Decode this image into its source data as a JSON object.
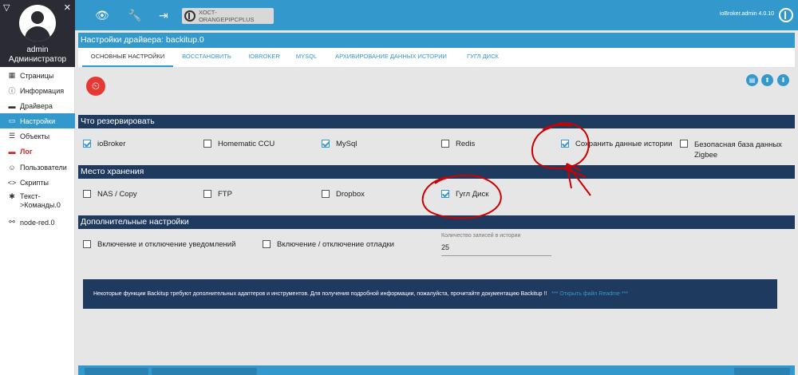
{
  "sidebar": {
    "user": "admin",
    "role": "Администратор",
    "items": [
      {
        "label": "Страницы",
        "icon": "grid-icon"
      },
      {
        "label": "Информация",
        "icon": "info-icon"
      },
      {
        "label": "Драйвера",
        "icon": "store-icon"
      },
      {
        "label": "Настройки",
        "icon": "settings-icon"
      },
      {
        "label": "Объекты",
        "icon": "objects-icon"
      },
      {
        "label": "Лог",
        "icon": "log-icon"
      },
      {
        "label": "Пользователи",
        "icon": "user-icon"
      },
      {
        "label": "Скрипты",
        "icon": "code-icon"
      },
      {
        "label": "Текст->Команды.0",
        "icon": "asterisk-icon"
      },
      {
        "label": "node-red.0",
        "icon": "node-red-icon"
      }
    ]
  },
  "topbar": {
    "host": "ХОСТ- ORANGEPIPCPLUS",
    "version": "ioBroker.admin 4.0.10"
  },
  "page": {
    "title": "Настройки драйвера: backitup.0"
  },
  "tabs": [
    {
      "label": "ОСНОВНЫЕ НАСТРОЙКИ"
    },
    {
      "label": "ВОССТАНОВИТЬ"
    },
    {
      "label": "IOBROKER"
    },
    {
      "label": "MYSQL"
    },
    {
      "label": "АРХИВИРОВАНИЕ ДАННЫХ ИСТОРИИ"
    },
    {
      "label": "ГУГЛ ДИСК"
    }
  ],
  "sections": {
    "backup": {
      "title": "Что резервировать",
      "options": [
        {
          "label": "ioBroker",
          "checked": true
        },
        {
          "label": "Homematic CCU",
          "checked": false
        },
        {
          "label": "MySql",
          "checked": true
        },
        {
          "label": "Redis",
          "checked": false
        },
        {
          "label": "Сохранить данные истории",
          "checked": true
        },
        {
          "label": "Безопасная база данных Zigbee",
          "checked": false
        }
      ]
    },
    "storage": {
      "title": "Место хранения",
      "options": [
        {
          "label": "NAS / Copy",
          "checked": false
        },
        {
          "label": "FTP",
          "checked": false
        },
        {
          "label": "Dropbox",
          "checked": false
        },
        {
          "label": "Гугл Диск",
          "checked": true
        }
      ]
    },
    "advanced": {
      "title": "Дополнительные настройки",
      "options": [
        {
          "label": "Включение и отключение уведомлений",
          "checked": false
        },
        {
          "label": "Включение / отключение отладки",
          "checked": false
        }
      ],
      "history_label": "Количество записей в истории",
      "history_value": "25"
    }
  },
  "info": {
    "text": "Некоторые функции Backitup требуют дополнительных адаптеров и инструментов. Для получения подробной информации, пожалуйста, прочитайте документацию Backitup !!",
    "link": "*** Открыть файл Readme ***"
  },
  "colors": {
    "accent": "#3399cc",
    "section": "#1f3a5f",
    "annotation": "#cc0000"
  }
}
